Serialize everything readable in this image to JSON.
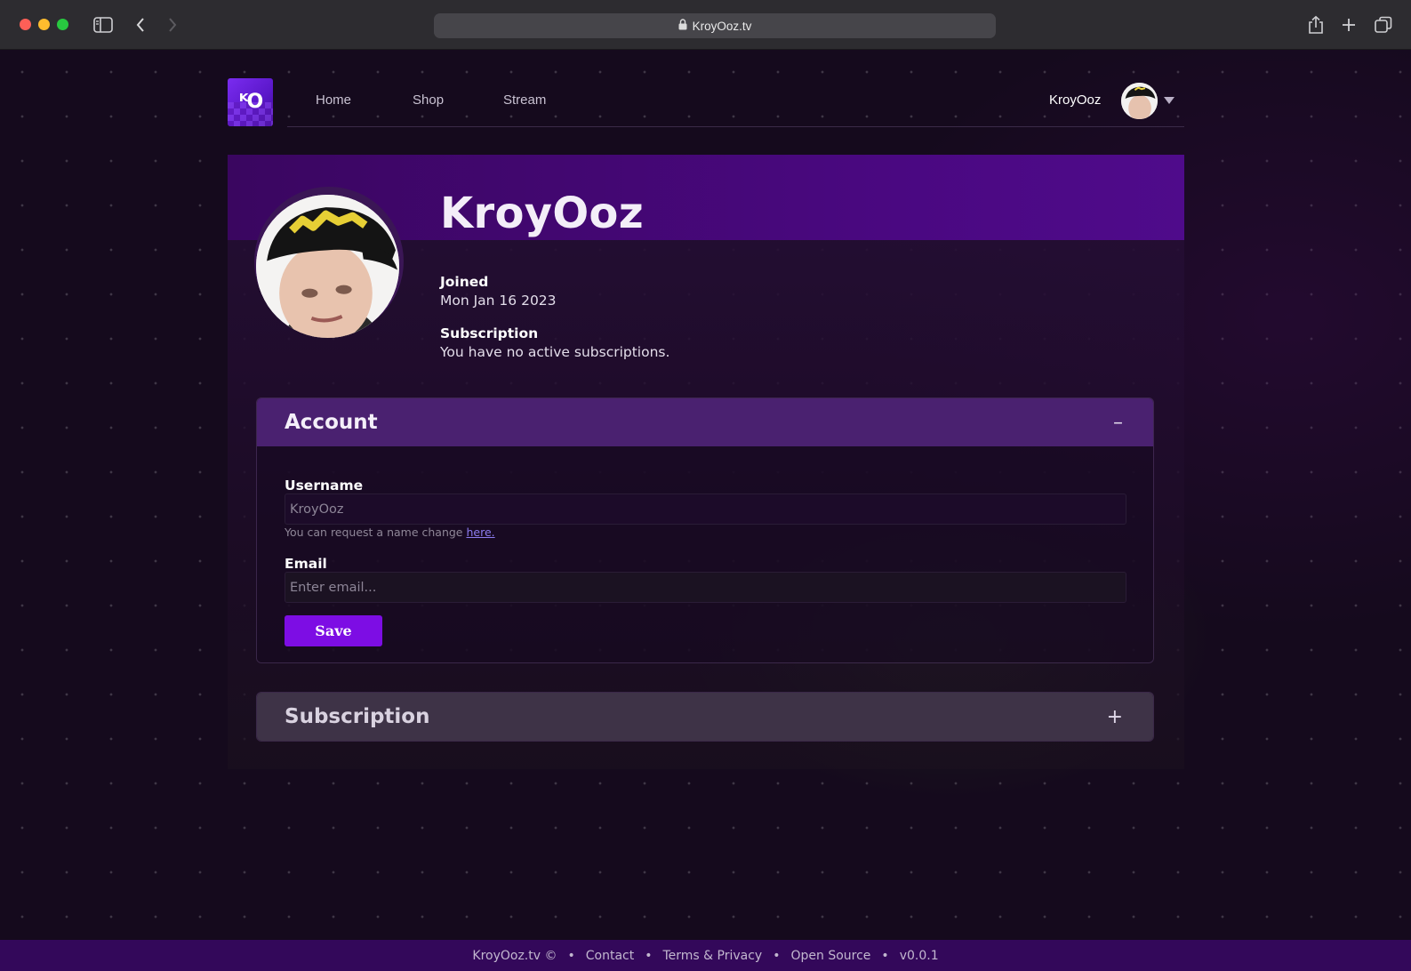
{
  "browser": {
    "url": "KroyOoz.tv",
    "icons": [
      "sidebar-icon",
      "back-icon",
      "forward-icon",
      "lock-icon",
      "share-icon",
      "new-tab-icon",
      "tabs-overview-icon"
    ]
  },
  "nav": {
    "links": [
      {
        "label": "Home"
      },
      {
        "label": "Shop"
      },
      {
        "label": "Stream"
      }
    ],
    "username": "KroyOoz"
  },
  "profile": {
    "name": "KroyOoz",
    "joined_label": "Joined",
    "joined_value": "Mon Jan 16 2023",
    "subscription_label": "Subscription",
    "subscription_value": "You have no active subscriptions."
  },
  "account_section": {
    "title": "Account",
    "toggle": "–",
    "username_label": "Username",
    "username_value": "KroyOoz",
    "hint_text": "You can request a name change",
    "hint_link": "here.",
    "email_label": "Email",
    "email_placeholder": "Enter email...",
    "save_label": "Save"
  },
  "subscription_section": {
    "title": "Subscription",
    "toggle": "+"
  },
  "footer": {
    "copyright": "KroyOoz.tv ©",
    "links": [
      "Contact",
      "Terms & Privacy",
      "Open Source"
    ],
    "version": "v0.0.1",
    "separator": "•"
  },
  "colors": {
    "brand_purple": "#7d0de4",
    "banner": "#4a0881",
    "footer": "#33085a",
    "account_header": "#4a2170",
    "subscription_header": "#3e3347"
  }
}
